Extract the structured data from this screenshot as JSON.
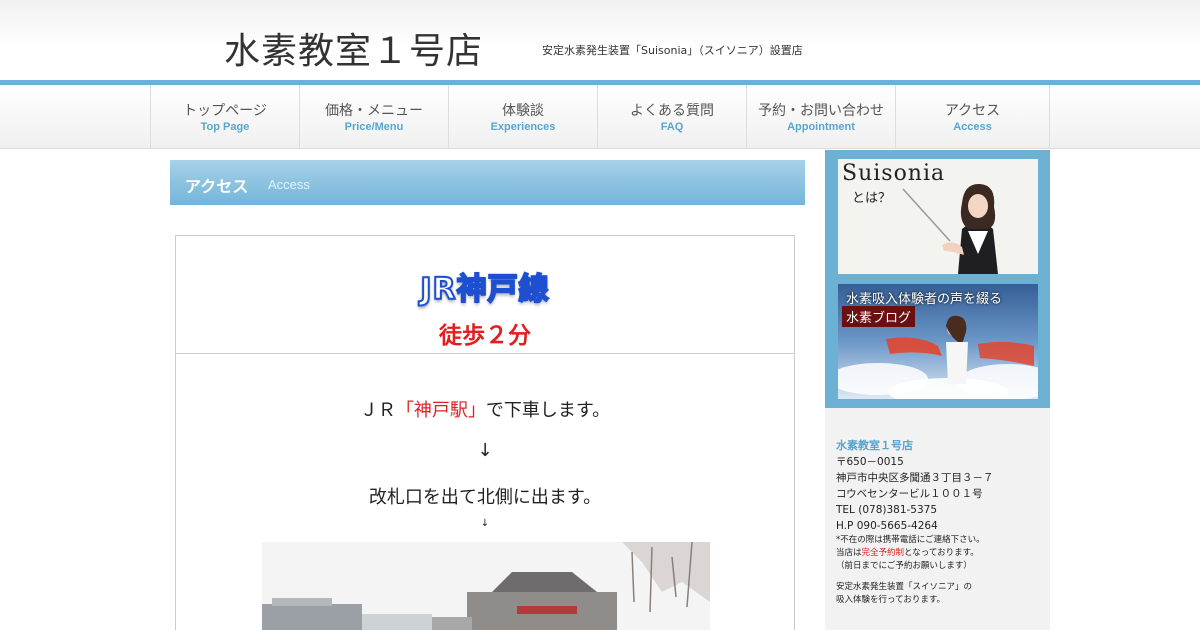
{
  "header": {
    "site_title": "水素教室１号店",
    "site_desc": "安定水素発生装置「Suisonia」（スイソニア）設置店"
  },
  "nav": {
    "items": [
      {
        "ja": "トップページ",
        "en": "Top Page"
      },
      {
        "ja": "価格・メニュー",
        "en": "Price/Menu"
      },
      {
        "ja": "体験談",
        "en": "Experiences"
      },
      {
        "ja": "よくある質問",
        "en": "FAQ"
      },
      {
        "ja": "予約・お問い合わせ",
        "en": "Appointment"
      },
      {
        "ja": "アクセス",
        "en": "Access"
      }
    ]
  },
  "page": {
    "title_ja": "アクセス",
    "title_en": "Access"
  },
  "content": {
    "line_name": "JR神戸線",
    "walk_time": "徒歩２分",
    "step1_pre": "ＪＲ",
    "step1_station": "「神戸駅」",
    "step1_post": "で下車します。",
    "arrow": "↓",
    "step2": "改札口を出て北側に出ます。",
    "arrow_small": "↓"
  },
  "sidebar": {
    "banner1_title": "Suisonia",
    "banner1_sub": "とは？",
    "banner2_title": "水素吸入体験者の声を綴る",
    "banner2_tag": "水素ブログ",
    "shop_name": "水素教室１号店",
    "postal": "〒650－0015",
    "address1": "神戸市中央区多聞通３丁目３－７",
    "address2": "コウベセンタービル１００１号",
    "tel": "TEL (078)381-5375",
    "hp": "H.P 090-5665-4264",
    "note1": "*不在の際は携帯電話にご連絡下さい。",
    "note2_pre": "当店は",
    "note2_red": "完全予約制",
    "note2_post": "となっております。",
    "note3": "（前日までにご予約お願いします）",
    "desc1": "安定水素発生装置「スイソニア」の",
    "desc2": "吸入体験を行っております。"
  },
  "colors": {
    "accent_blue": "#6cb1d4",
    "red": "#e02020",
    "line_blue": "#1f4fd1"
  }
}
